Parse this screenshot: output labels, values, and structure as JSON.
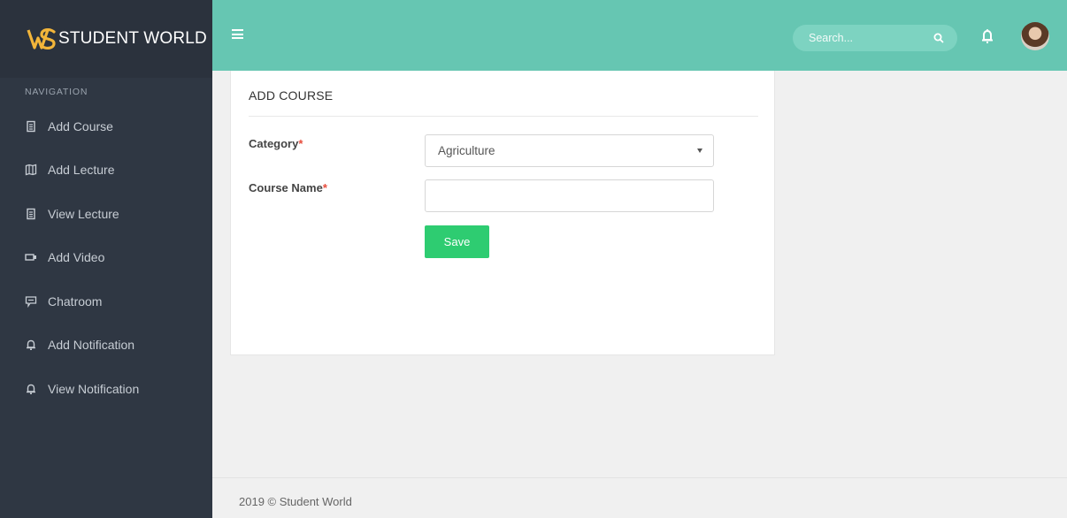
{
  "brand": {
    "name": "STUDENT WORLD",
    "logo_icon": "sw-logo-icon",
    "logo_color": "#f2b53a"
  },
  "sidebar": {
    "heading": "NAVIGATION",
    "items": [
      {
        "label": "Add Course",
        "icon": "document-icon"
      },
      {
        "label": "Add Lecture",
        "icon": "map-icon"
      },
      {
        "label": "View Lecture",
        "icon": "document-icon"
      },
      {
        "label": "Add Video",
        "icon": "video-icon"
      },
      {
        "label": "Chatroom",
        "icon": "chat-icon"
      },
      {
        "label": "Add Notification",
        "icon": "bell-icon"
      },
      {
        "label": "View Notification",
        "icon": "bell-icon"
      }
    ]
  },
  "topbar": {
    "search_placeholder": "Search...",
    "menu_icon": "hamburger-icon",
    "accent": "#66c6b2"
  },
  "form": {
    "title": "ADD COURSE",
    "category_label": "Category",
    "category_value": "Agriculture",
    "course_name_label": "Course Name",
    "course_name_value": "",
    "required_marker": "*",
    "save_label": "Save",
    "save_color": "#2ecc71"
  },
  "footer": {
    "text": "2019 © Student World"
  }
}
